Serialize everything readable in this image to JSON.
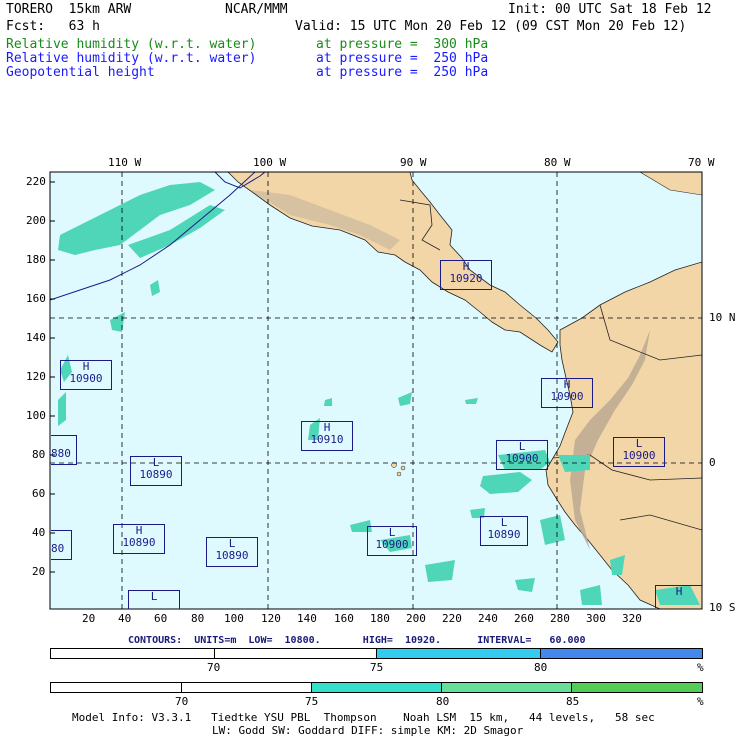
{
  "header": {
    "model": "TORERO  15km ARW",
    "center": "NCAR/MMM",
    "init": "Init: 00 UTC Sat 18 Feb 12",
    "fcst": "Fcst:   63 h",
    "valid": "Valid: 15 UTC Mon 20 Feb 12 (09 CST Mon 20 Feb 12)",
    "fields": [
      {
        "name": "Relative humidity (w.r.t. water)",
        "level": "at pressure =  300 hPa",
        "color": "#1a8a1a"
      },
      {
        "name": "Relative humidity (w.r.t. water)",
        "level": "at pressure =  250 hPa",
        "color": "#1a1aff"
      },
      {
        "name": "Geopotential height",
        "level": "at pressure =  250 hPa",
        "color": "#1a1aff"
      }
    ]
  },
  "map": {
    "lon_labels": [
      "110 W",
      "100 W",
      "90 W",
      "80 W",
      "70 W"
    ],
    "lat_labels": [
      "10 N",
      "0",
      "10 S"
    ],
    "y_ticks": [
      "220",
      "200",
      "180",
      "160",
      "140",
      "120",
      "100",
      "80",
      "60",
      "40",
      "20"
    ],
    "x_ticks": [
      "20",
      "40",
      "60",
      "80",
      "100",
      "120",
      "140",
      "160",
      "180",
      "200",
      "220",
      "240",
      "260",
      "280",
      "300",
      "320"
    ],
    "height_centers": [
      {
        "type": "H",
        "value": "10920"
      },
      {
        "type": "H",
        "value": "10900"
      },
      {
        "type": "H",
        "value": "10900"
      },
      {
        "type": "H",
        "value": "10910"
      },
      {
        "type": "L",
        "value": "10900"
      },
      {
        "type": "L",
        "value": "10900"
      },
      {
        "type": "L",
        "value": "10890"
      },
      {
        "type": "L",
        "value": "10890"
      },
      {
        "type": "H",
        "value": "10890"
      },
      {
        "type": "L",
        "value": "10890"
      },
      {
        "type": "L",
        "value": "10900"
      },
      {
        "type": "L",
        "value": ""
      },
      {
        "type": "H",
        "value": ""
      }
    ],
    "edge_labels": [
      "880",
      "80"
    ]
  },
  "contours": {
    "line": "CONTOURS:  UNITS=m  LOW=  10800.       HIGH=  10920.      INTERVAL=   60.000"
  },
  "colorbar_250": {
    "labels": [
      "70",
      "75",
      "80",
      "%"
    ],
    "colors": [
      "#ffffff",
      "#ffffff",
      "#33ccee",
      "#4488ee"
    ]
  },
  "colorbar_300": {
    "labels": [
      "70",
      "75",
      "80",
      "85",
      "%"
    ],
    "colors": [
      "#ffffff",
      "#ffffff",
      "#33e0cc",
      "#66e099",
      "#55cc55"
    ]
  },
  "footer": {
    "line1": "Model Info: V3.3.1   Tiedtke YSU PBL  Thompson    Noah LSM  15 km,   44 levels,   58 sec",
    "line2": "LW: Godd SW: Goddard DIFF: simple KM: 2D Smagor"
  }
}
